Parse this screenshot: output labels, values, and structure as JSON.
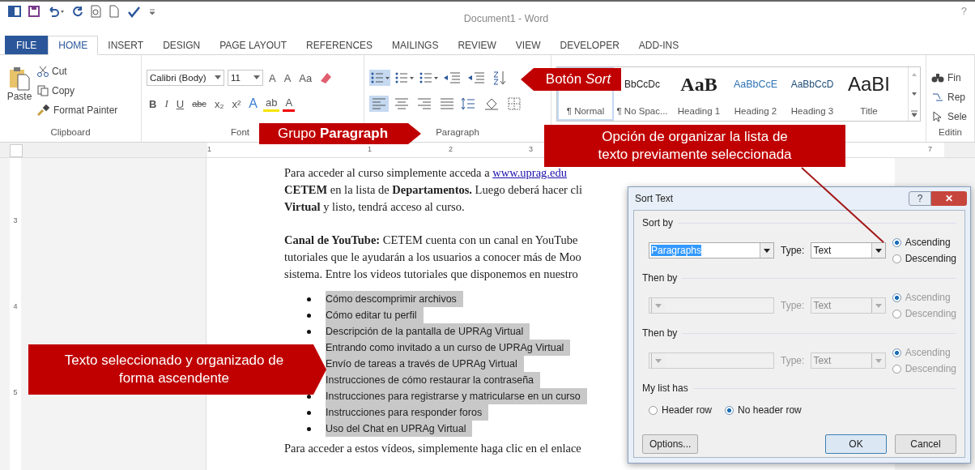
{
  "window": {
    "title": "Document1 - Word",
    "help": "?"
  },
  "tabs": [
    {
      "label": "FILE",
      "kind": "file",
      "selected": false
    },
    {
      "label": "HOME",
      "kind": "tab",
      "selected": true
    },
    {
      "label": "INSERT",
      "kind": "tab",
      "selected": false
    },
    {
      "label": "DESIGN",
      "kind": "tab",
      "selected": false
    },
    {
      "label": "PAGE LAYOUT",
      "kind": "tab",
      "selected": false
    },
    {
      "label": "REFERENCES",
      "kind": "tab",
      "selected": false
    },
    {
      "label": "MAILINGS",
      "kind": "tab",
      "selected": false
    },
    {
      "label": "REVIEW",
      "kind": "tab",
      "selected": false
    },
    {
      "label": "VIEW",
      "kind": "tab",
      "selected": false
    },
    {
      "label": "DEVELOPER",
      "kind": "tab",
      "selected": false
    },
    {
      "label": "ADD-INS",
      "kind": "tab",
      "selected": false
    }
  ],
  "clipboard": {
    "paste": "Paste",
    "cut": "Cut",
    "copy": "Copy",
    "format_painter": "Format Painter",
    "label": "Clipboard"
  },
  "font": {
    "name": "Calibri (Body)",
    "size": "11",
    "row1": [
      "A",
      "A",
      "Aa"
    ],
    "row2": [
      "B",
      "I",
      "U",
      "abc",
      "x₂",
      "x²",
      "A",
      "ab",
      "A"
    ],
    "label": "Font"
  },
  "paragraph": {
    "label": "Paragraph",
    "row1": [
      {
        "kind": "bullets",
        "selected": true
      },
      {
        "kind": "numbering",
        "selected": false
      },
      {
        "kind": "multilevel",
        "selected": false
      },
      {
        "kind": "outdent",
        "selected": false
      },
      {
        "kind": "indent",
        "selected": false
      },
      {
        "kind": "sort",
        "selected": false
      }
    ],
    "row2": [
      {
        "kind": "left",
        "selected": true
      },
      {
        "kind": "center",
        "selected": false
      },
      {
        "kind": "right",
        "selected": false
      },
      {
        "kind": "justify",
        "selected": false
      },
      {
        "kind": "spacing",
        "selected": false
      },
      {
        "kind": "shading",
        "selected": false
      },
      {
        "kind": "borders",
        "selected": false
      }
    ]
  },
  "styles": {
    "items": [
      {
        "name": "¶ Normal",
        "selected": true
      },
      {
        "preview": "BbCcDc",
        "name": "¶ No Spac...",
        "kind": "plain",
        "selected": false
      },
      {
        "preview": "AaB",
        "name": "Heading 1",
        "kind": "h1",
        "selected": false
      },
      {
        "preview": "AaBbCcE",
        "name": "Heading 2",
        "kind": "h2",
        "selected": false
      },
      {
        "preview": "AaBbCcD",
        "name": "Heading 3",
        "kind": "h3",
        "selected": false
      },
      {
        "preview": "AaBI",
        "name": "Title",
        "kind": "title",
        "selected": false
      }
    ]
  },
  "editing": {
    "items": [
      "Fin",
      "Rep",
      "Sele"
    ],
    "label": "Editin"
  },
  "ruler": {
    "marks": [
      "1",
      "1",
      "2",
      "3",
      "7"
    ],
    "vertical": [
      "3",
      "4",
      "5"
    ]
  },
  "document": {
    "intro": [
      "Para acceder al curso simplemente acceda a",
      "**CETEM** en la lista de **Departamentos.** Luego deberá hacer cli",
      "**Virtual** y listo, tendrá acceso al curso."
    ],
    "link": "www.uprag.edu",
    "youtube": [
      "**Canal de YouTube:** CETEM cuenta con un canal en YouTube",
      "tutoriales que le ayudarán a los usuarios a conocer más de Moo",
      "sistema. Entre los videos tutoriales que disponemos en nuestro"
    ],
    "list": [
      {
        "text": "Cómo descomprimir archivos",
        "selected": true
      },
      {
        "text": "Cómo editar tu perfil",
        "selected": true
      },
      {
        "text": "Descripción de la pantalla de UPRAg Virtual",
        "selected": true
      },
      {
        "text": "Entrando como invitado a un curso de UPRAg Virtual",
        "selected": true
      },
      {
        "text": "Envío de tareas a través de UPRAg Virtual",
        "selected": true
      },
      {
        "text": "Instrucciones de cómo restaurar la contraseña",
        "selected": true
      },
      {
        "text": "Instrucciones para registrarse y matricularse en un curso",
        "selected": true
      },
      {
        "text": "Instrucciones para responder foros",
        "selected": true
      },
      {
        "text": "Uso del Chat en UPRAg Virtual",
        "selected": true
      }
    ],
    "outro": "Para acceder a estos vídeos, simplemente haga clic en el enlace"
  },
  "dialog": {
    "title": "Sort Text",
    "help": "?",
    "close": "✕",
    "sections": [
      {
        "label": "Sort by",
        "field": "Paragraphs",
        "type_label": "Type:",
        "type": "Text",
        "disabled": false,
        "options": [
          {
            "label": "Ascending",
            "selected": true
          },
          {
            "label": "Descending",
            "selected": false
          }
        ]
      },
      {
        "label": "Then by",
        "type_label": "Type:",
        "type": "Text",
        "disabled": true,
        "options": [
          {
            "label": "Ascending",
            "selected": true
          },
          {
            "label": "Descending",
            "selected": false
          }
        ]
      },
      {
        "label": "Then by",
        "type_label": "Type:",
        "type": "Text",
        "disabled": true,
        "options": [
          {
            "label": "Ascending",
            "selected": true
          },
          {
            "label": "Descending",
            "selected": false
          }
        ]
      }
    ],
    "list_has": {
      "label": "My list has",
      "options": [
        {
          "label": "Header row",
          "selected": false
        },
        {
          "label": "No header row",
          "selected": true
        }
      ]
    },
    "buttons": [
      {
        "label": "Options...",
        "kind": "options"
      },
      {
        "label": "OK",
        "kind": "default"
      },
      {
        "label": "Cancel",
        "kind": "normal"
      }
    ]
  },
  "callouts": [
    {
      "text": "Botón *Sort*",
      "kind": "left"
    },
    {
      "text": "Grupo **Paragraph**",
      "kind": "right"
    },
    {
      "text": "Opción de organizar la lista de texto previamente seleccionada",
      "kind": "box"
    },
    {
      "text": "Texto seleccionado y organizado de forma ascendente",
      "kind": "right"
    }
  ]
}
